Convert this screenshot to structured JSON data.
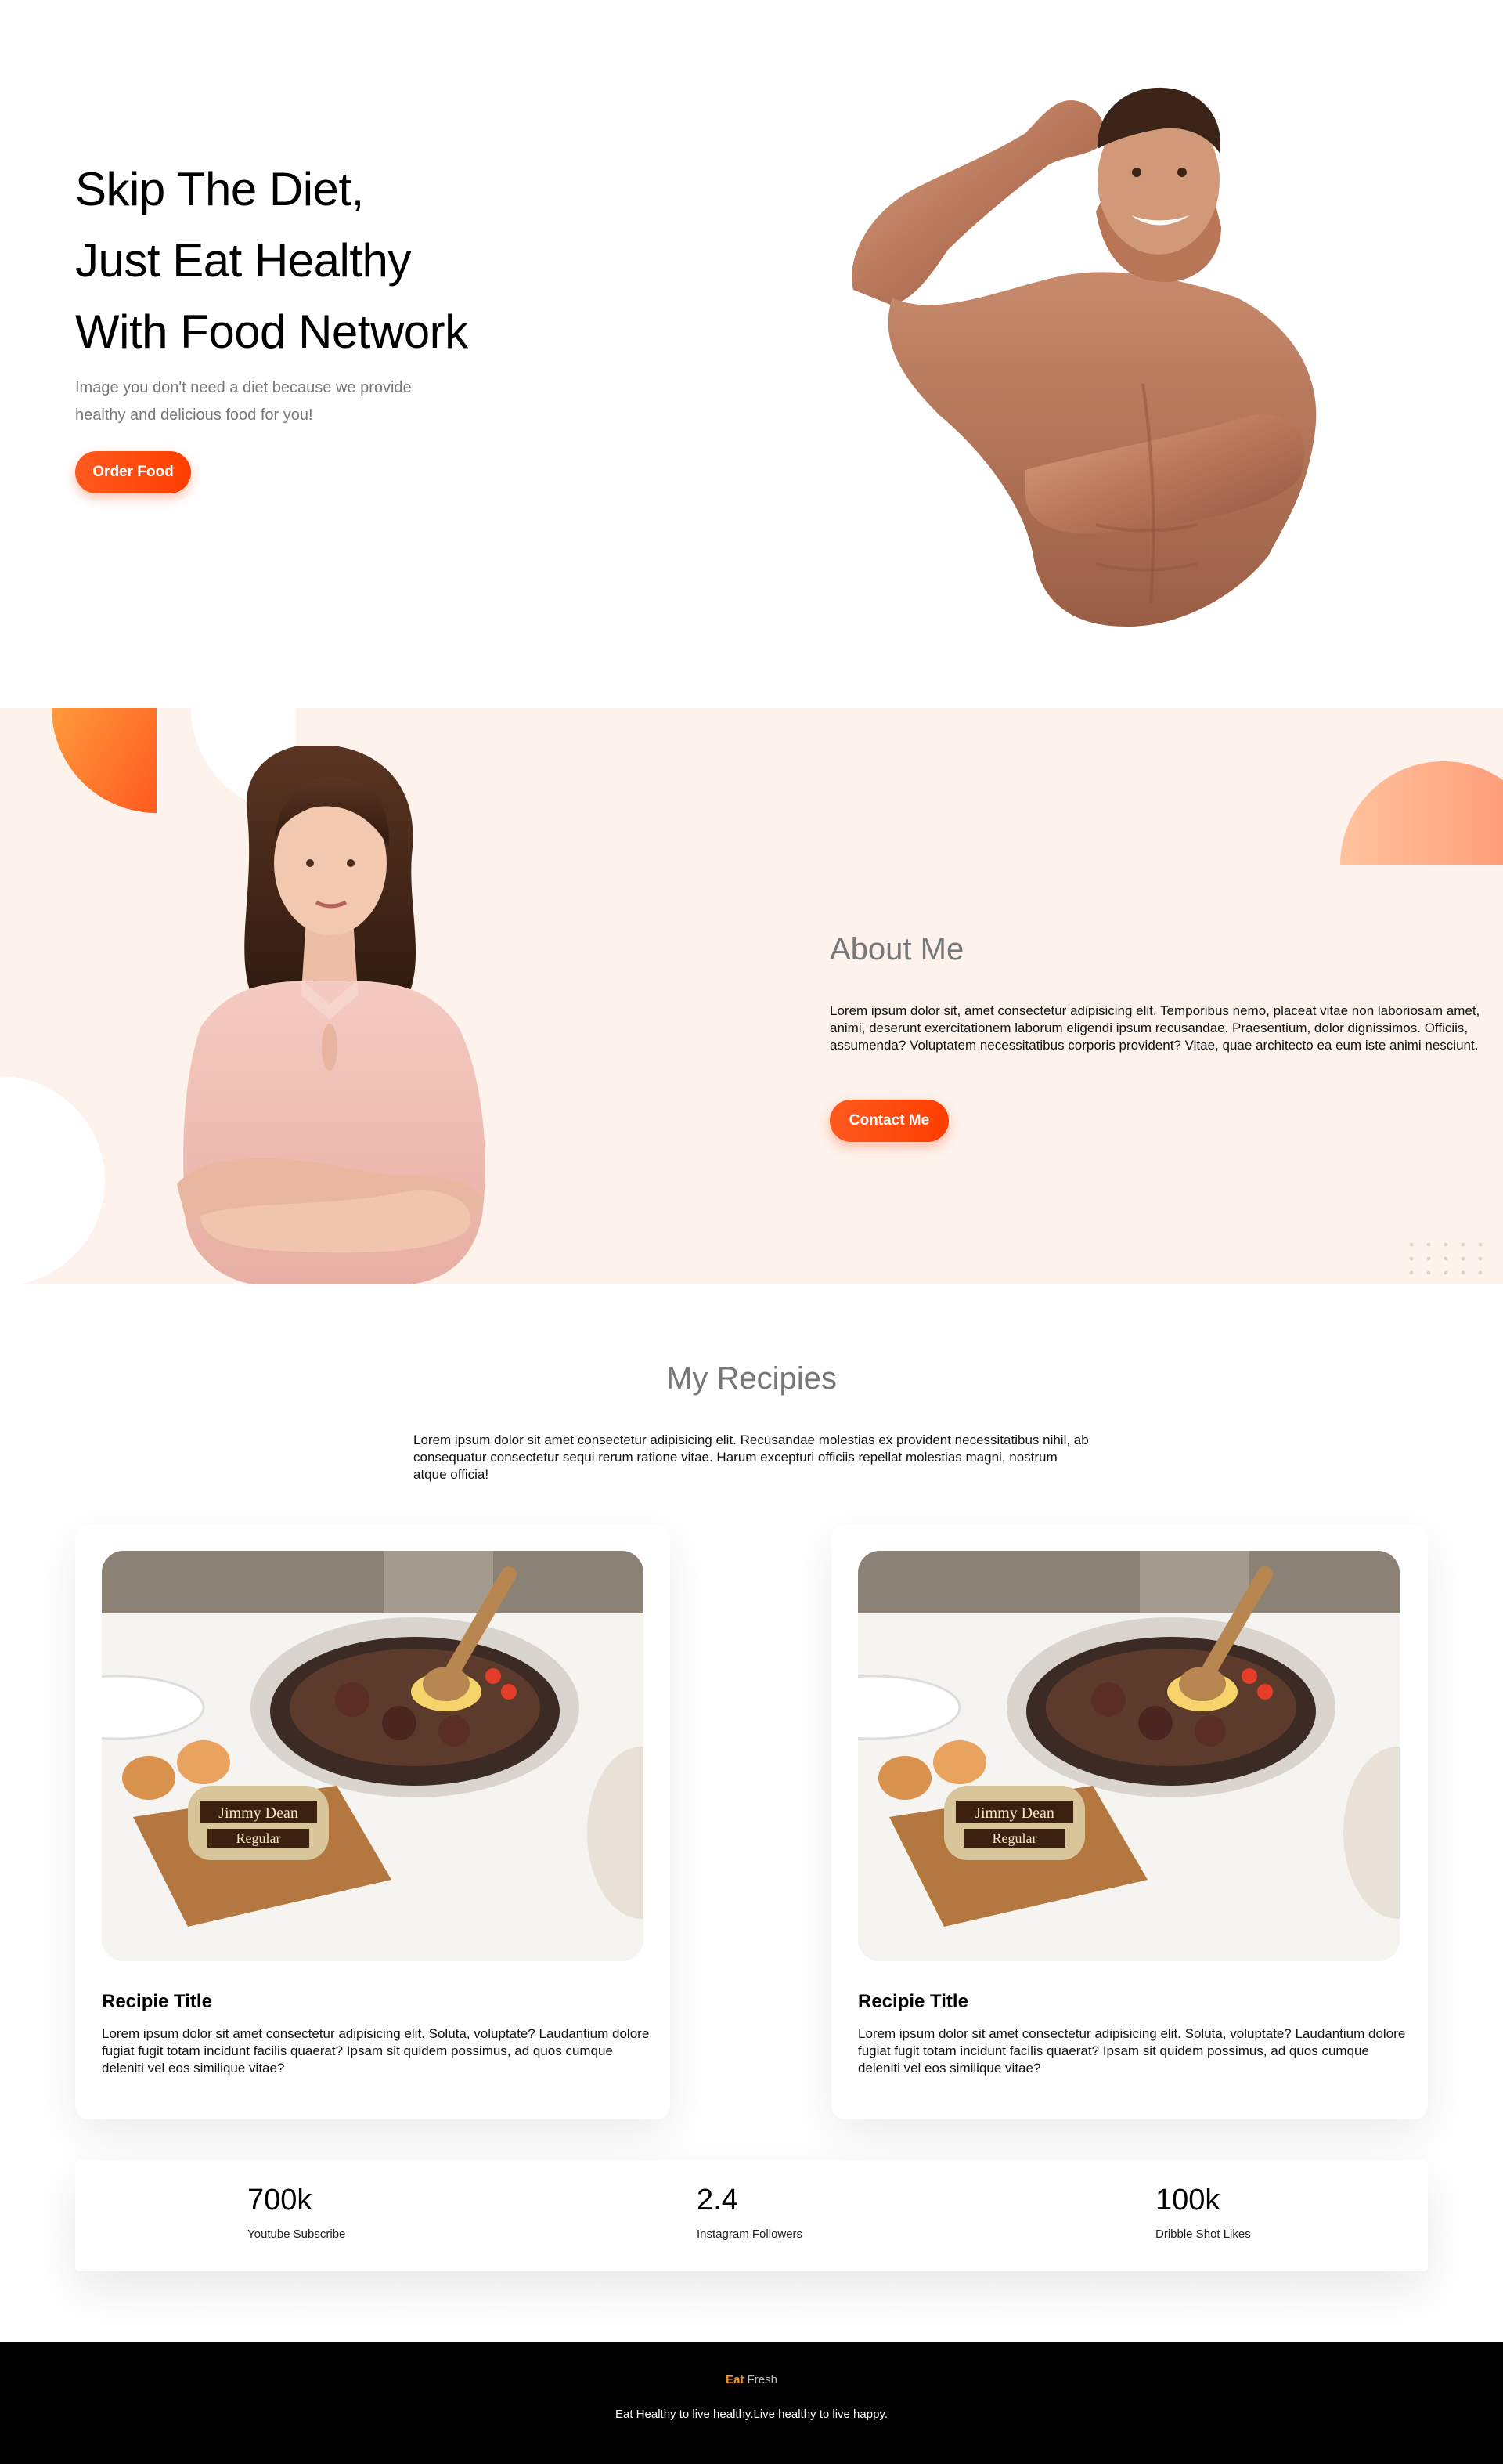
{
  "hero": {
    "title_lines": [
      "Skip The Diet,",
      "Just Eat Healthy",
      "With Food Network"
    ],
    "subtitle": "Image you don't need a diet because we provide healthy and delicious food for you!",
    "cta": "Order Food"
  },
  "about": {
    "title": "About Me",
    "text": "Lorem ipsum dolor sit, amet consectetur adipisicing elit. Temporibus nemo, placeat vitae non laboriosam amet, animi, deserunt exercitationem laborum eligendi ipsum recusandae. Praesentium, dolor dignissimos. Officiis, assumenda? Voluptatem necessitatibus corporis provident? Vitae, quae architecto ea eum iste animi nesciunt.",
    "cta": "Contact Me"
  },
  "recipes": {
    "title": "My Recipies",
    "text": "Lorem ipsum dolor sit amet consectetur adipisicing elit. Recusandae molestias ex provident necessitatibus nihil, ab consequatur consectetur sequi rerum ratione vitae. Harum excepturi officiis repellat molestias magni, nostrum atque officia!",
    "cards": [
      {
        "title": "Recipie Title",
        "text": "Lorem ipsum dolor sit amet consectetur adipisicing elit. Soluta, voluptate? Laudantium dolore fugiat fugit totam incidunt facilis quaerat? Ipsam sit quidem possimus, ad quos cumque deleniti vel eos similique vitae?",
        "image_label_1": "Jimmy Dean",
        "image_label_2": "Regular"
      },
      {
        "title": "Recipie Title",
        "text": "Lorem ipsum dolor sit amet consectetur adipisicing elit. Soluta, voluptate? Laudantium dolore fugiat fugit totam incidunt facilis quaerat? Ipsam sit quidem possimus, ad quos cumque deleniti vel eos similique vitae?",
        "image_label_1": "Jimmy Dean",
        "image_label_2": "Regular"
      }
    ]
  },
  "stats": [
    {
      "value": "700k",
      "label": "Youtube Subscribe"
    },
    {
      "value": "2.4",
      "label": "Instagram Followers"
    },
    {
      "value": "100k",
      "label": "Dribble Shot Likes"
    }
  ],
  "footer": {
    "brand_eat": "Eat",
    "brand_fresh": "Fresh",
    "tagline": "Eat Healthy to live healthy.Live healthy to live happy."
  },
  "colors": {
    "accent": "#ff4d12",
    "about_bg": "#fdf2ec",
    "brand_eat": "#ff9a1f"
  }
}
